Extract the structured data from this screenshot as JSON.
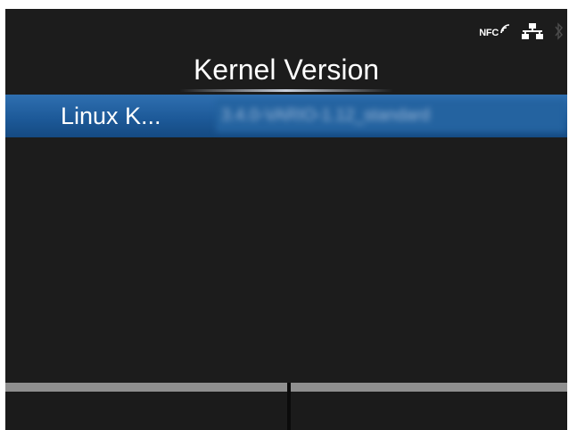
{
  "status": {
    "nfc_label": "NFC",
    "icons": [
      "nfc-icon",
      "network-icon",
      "bluetooth-icon"
    ]
  },
  "header": {
    "title": "Kernel Version"
  },
  "list": {
    "items": [
      {
        "label": "Linux K...",
        "value": "3.4.0-VARIO-1.12_standard",
        "selected": true
      }
    ]
  },
  "footer": {
    "softkeys": [
      "",
      ""
    ]
  },
  "colors": {
    "background": "#1c1c1c",
    "selection": "#1d5a99",
    "text": "#ffffff",
    "softkey_bar": "#8f8f8f"
  }
}
